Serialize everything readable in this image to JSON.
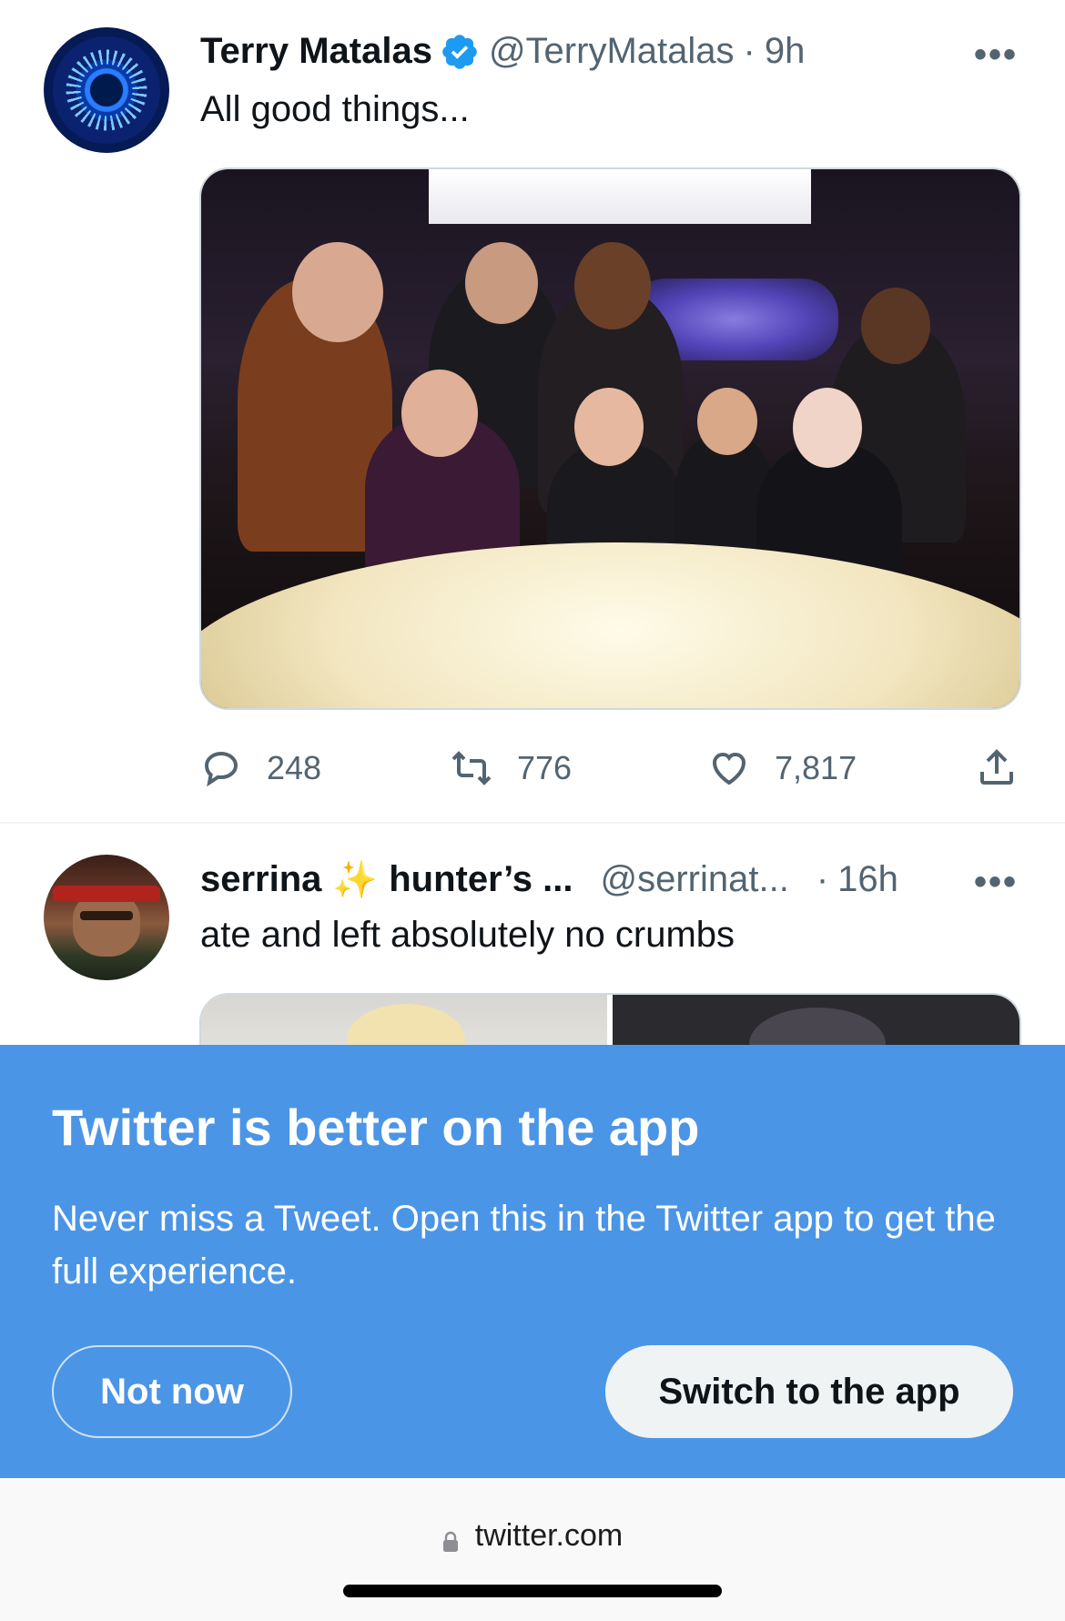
{
  "tweets": [
    {
      "author_name": "Terry Matalas",
      "verified": true,
      "handle": "@TerryMatalas",
      "separator": "·",
      "time": "9h",
      "more_label": "•••",
      "text": "All good things...",
      "replies": "248",
      "retweets": "776",
      "likes": "7,817"
    },
    {
      "author_name": "serrina",
      "name_emoji": "✨",
      "author_name_suffix": "hunter’s ...",
      "handle": "@serrinat...",
      "separator": "·",
      "time": "16h",
      "more_label": "•••",
      "text": "ate and left absolutely no crumbs"
    }
  ],
  "banner": {
    "title": "Twitter is better on the app",
    "body": "Never miss a Tweet. Open this in the Twitter app to get the full experience.",
    "secondary_button": "Not now",
    "primary_button": "Switch to the app",
    "background_color": "#4b95e6"
  },
  "browser": {
    "url": "twitter.com"
  },
  "icons": {
    "reply": "reply-icon",
    "retweet": "retweet-icon",
    "like": "heart-icon",
    "share": "share-icon",
    "verified": "verified-badge-icon",
    "lock": "lock-icon"
  }
}
